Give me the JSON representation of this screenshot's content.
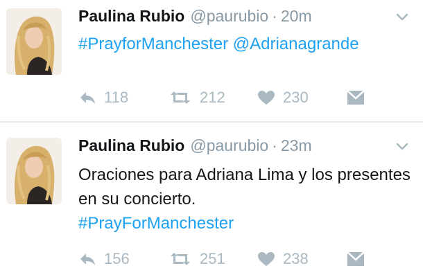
{
  "tweets": [
    {
      "author_name": "Paulina Rubio",
      "handle": "@paurubio",
      "separator": "·",
      "time": "20m",
      "text_parts": [
        {
          "text": "#PrayforManchester",
          "type": "hashtag"
        },
        {
          "text": " ",
          "type": "text"
        },
        {
          "text": "@Adrianagrande",
          "type": "mention"
        }
      ],
      "reply_count": "118",
      "retweet_count": "212",
      "like_count": "230"
    },
    {
      "author_name": "Paulina Rubio",
      "handle": "@paurubio",
      "separator": "·",
      "time": "23m",
      "text_parts": [
        {
          "text": "Oraciones para Adriana Lima y los presentes en su concierto.",
          "type": "text"
        },
        {
          "text": "#PrayForManchester",
          "type": "hashtag"
        }
      ],
      "reply_count": "156",
      "retweet_count": "251",
      "like_count": "238"
    }
  ],
  "icons": {
    "reply": "reply-icon",
    "retweet": "retweet-icon",
    "like": "heart-icon",
    "message": "message-icon",
    "caret": "chevron-down-icon"
  },
  "colors": {
    "link": "#1da1f2",
    "muted": "#8899a6",
    "action": "#aab8c2",
    "text": "#14171a"
  }
}
